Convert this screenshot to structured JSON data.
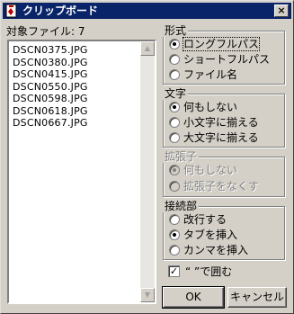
{
  "window": {
    "title": "クリップボード",
    "close_glyph": "×"
  },
  "file_count": {
    "label": "対象ファイル: ",
    "value": "7"
  },
  "files": [
    "DSCN0375.JPG",
    "DSCN0380.JPG",
    "DSCN0415.JPG",
    "DSCN0550.JPG",
    "DSCN0598.JPG",
    "DSCN0618.JPG",
    "DSCN0667.JPG"
  ],
  "groups": {
    "format": {
      "title": "形式",
      "options": [
        "ロングフルパス",
        "ショートフルパス",
        "ファイル名"
      ],
      "selected": 0
    },
    "case": {
      "title": "文字",
      "options": [
        "何もしない",
        "小文字に揃える",
        "大文字に揃える"
      ],
      "selected": 0
    },
    "extension": {
      "title": "拡張子",
      "options": [
        "何もしない",
        "拡張子をなくす"
      ],
      "selected": 0,
      "disabled": true
    },
    "separator": {
      "title": "接続部",
      "options": [
        "改行する",
        "タブを挿入",
        "カンマを挿入"
      ],
      "selected": 1
    }
  },
  "quote_check": {
    "label": "“ ”で囲む",
    "checked": true
  },
  "buttons": {
    "ok": "OK",
    "cancel": "キャンセル"
  },
  "colors": {
    "titlebar": "#0a246a",
    "face": "#d4d0c8"
  }
}
